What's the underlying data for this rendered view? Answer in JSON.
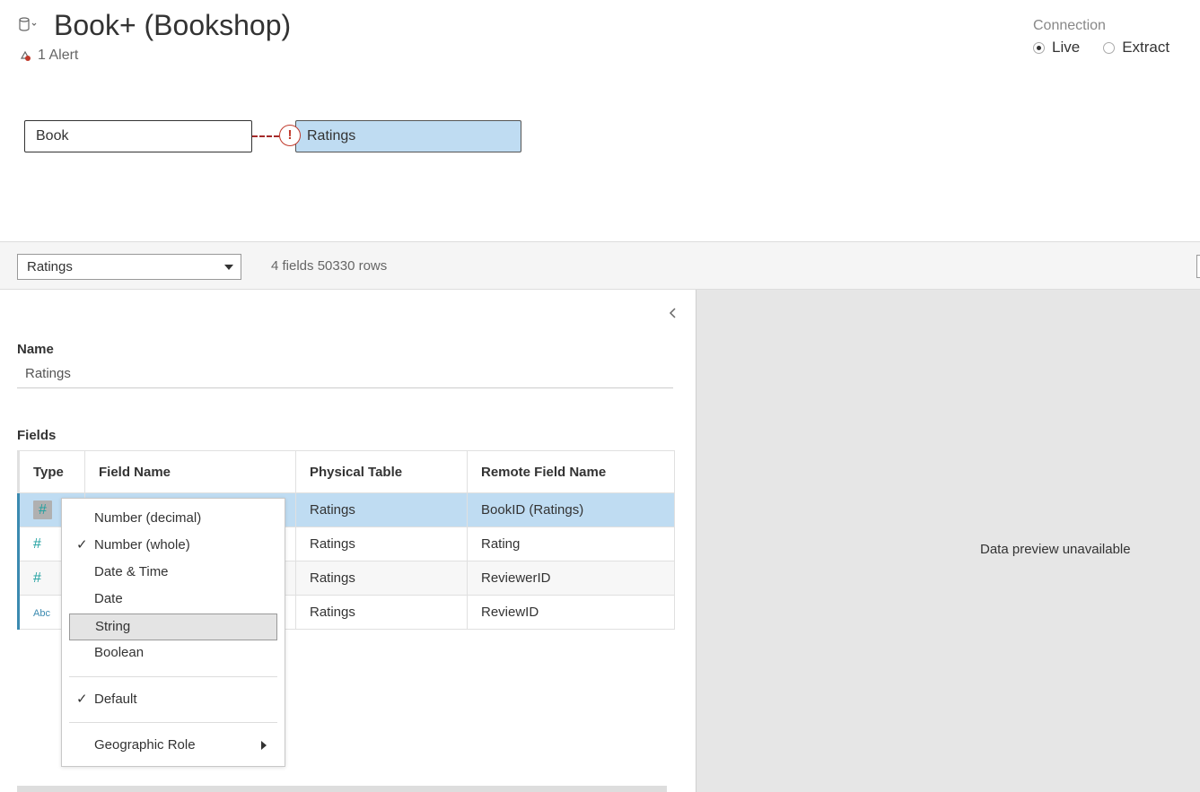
{
  "header": {
    "title": "Book+ (Bookshop)",
    "alert_text": "1 Alert",
    "connection_label": "Connection",
    "connection_options": [
      {
        "label": "Live",
        "selected": true
      },
      {
        "label": "Extract",
        "selected": false
      }
    ]
  },
  "canvas": {
    "tables": [
      "Book",
      "Ratings"
    ],
    "join_warning_glyph": "!"
  },
  "toolbar": {
    "selected_table": "Ratings",
    "counts": "4 fields 50330 rows"
  },
  "details": {
    "name_label": "Name",
    "name_value": "Ratings",
    "fields_label": "Fields",
    "columns": [
      "Type",
      "Field Name",
      "Physical Table",
      "Remote Field Name"
    ],
    "rows": [
      {
        "type_icon": "#",
        "field_name": "",
        "physical_table": "Ratings",
        "remote_field_name": "BookID (Ratings)",
        "selected": true
      },
      {
        "type_icon": "#",
        "field_name": "",
        "physical_table": "Ratings",
        "remote_field_name": "Rating",
        "selected": false
      },
      {
        "type_icon": "#",
        "field_name": "",
        "physical_table": "Ratings",
        "remote_field_name": "ReviewerID",
        "selected": false
      },
      {
        "type_icon": "Abc",
        "field_name": "",
        "physical_table": "Ratings",
        "remote_field_name": "ReviewID",
        "selected": false
      }
    ]
  },
  "type_menu": {
    "items": [
      {
        "label": "Number (decimal)",
        "checked": false
      },
      {
        "label": "Number (whole)",
        "checked": true
      },
      {
        "label": "Date & Time",
        "checked": false
      },
      {
        "label": "Date",
        "checked": false
      },
      {
        "label": "String",
        "checked": false,
        "highlighted": true
      },
      {
        "label": "Boolean",
        "checked": false
      }
    ],
    "default_label": "Default",
    "geo_label": "Geographic Role",
    "check_glyph": "✓"
  },
  "preview": {
    "message": "Data preview unavailable"
  },
  "icons": {
    "datasource": "datasource-icon",
    "alert": "alert-icon",
    "collapse": "chevron-left-icon",
    "number_type": "number-type-icon",
    "string_type": "string-type-icon",
    "submenu": "chevron-right-icon"
  },
  "colors": {
    "selected_row": "#bfdcf2",
    "join_warning": "#c0392b",
    "preview_bg": "#e6e6e6"
  }
}
